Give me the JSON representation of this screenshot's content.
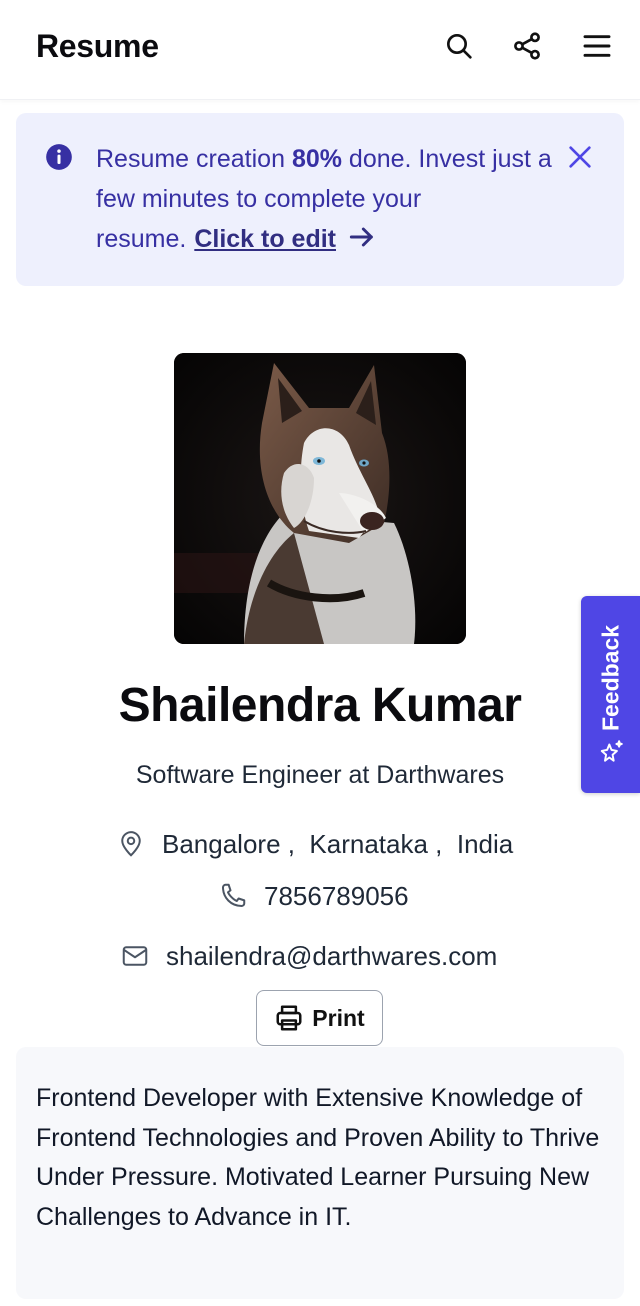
{
  "header": {
    "title": "Resume",
    "icons": [
      "search-icon",
      "share-icon",
      "menu-icon"
    ]
  },
  "banner": {
    "prefix": "Resume creation ",
    "percent": "80%",
    "suffix": " done. Invest just a few minutes to complete your resume.",
    "link_text": "Click to edit",
    "accent_color": "#3730a3",
    "background_color": "#eef0fd"
  },
  "profile": {
    "name": "Shailendra Kumar",
    "role": "Software Engineer at Darthwares",
    "location": "Bangalore ,  Karnataka ,  India",
    "phone": "7856789056",
    "email": "shailendra@darthwares.com"
  },
  "actions": {
    "print_label": "Print"
  },
  "summary": {
    "text": "Frontend Developer with Extensive Knowledge of Frontend Technologies and Proven Ability to Thrive Under Pressure. Motivated Learner Pursuing New Challenges to Advance in IT."
  },
  "feedback": {
    "label": "Feedback",
    "color": "#4f46e5"
  }
}
